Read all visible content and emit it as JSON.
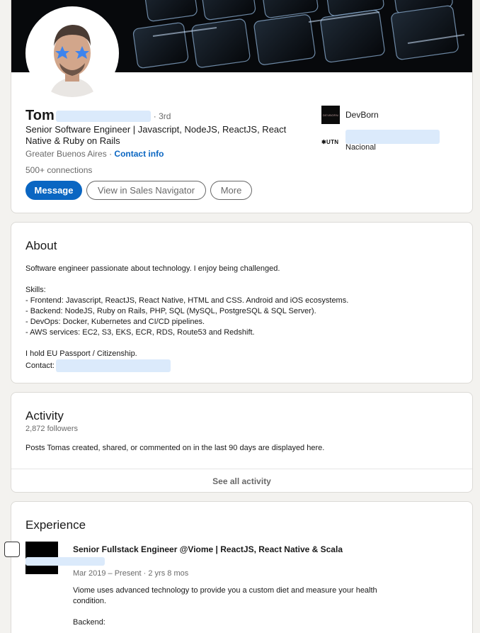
{
  "profile": {
    "first_name": "Tom",
    "degree": "· 3rd",
    "headline": "Senior Software Engineer | Javascript, NodeJS, ReactJS, React Native & Ruby on Rails",
    "location": "Greater Buenos Aires",
    "separator": " · ",
    "contact_link": "Contact info",
    "connections": "500+ connections",
    "buttons": {
      "message": "Message",
      "sales_navigator": "View in Sales Navigator",
      "more": "More"
    },
    "side_items": [
      {
        "logo_text": "DEVBORN",
        "name": "DevBorn"
      },
      {
        "logo_text": "✱UTN",
        "name": "Universidad Tecnológica Nacional"
      }
    ]
  },
  "about": {
    "title": "About",
    "lines": [
      "Software engineer passionate about technology. I enjoy being challenged.",
      "",
      "Skills:",
      "- Frontend: Javascript, ReactJS, React Native, HTML and CSS. Android and iOS ecosystems.",
      "- Backend: NodeJS, Ruby on Rails, PHP, SQL (MySQL, PostgreSQL & SQL Server).",
      "- DevOps: Docker, Kubernetes and CI/CD pipelines.",
      "- AWS services: EC2, S3, EKS, ECR, RDS, Route53 and Redshift.",
      "",
      "I hold EU Passport / Citizenship.",
      "Contact:"
    ]
  },
  "activity": {
    "title": "Activity",
    "followers": "2,872 followers",
    "description": "Posts Tomas created, shared, or commented on in the last 90 days are displayed here.",
    "see_all": "See all activity"
  },
  "experience": {
    "title": "Experience",
    "items": [
      {
        "title": "Senior Fullstack Engineer @Viome | ReactJS, React Native & Scala",
        "dates": "Mar 2019 – Present · 2 yrs 8 mos",
        "description_lines": [
          "Viome uses advanced technology to provide you a custom diet and measure your health",
          "condition.",
          "",
          "Backend:"
        ]
      }
    ]
  },
  "colors": {
    "accent": "#0a66c2",
    "page_bg": "#f3f2ef",
    "redaction": "#dbeafb"
  }
}
